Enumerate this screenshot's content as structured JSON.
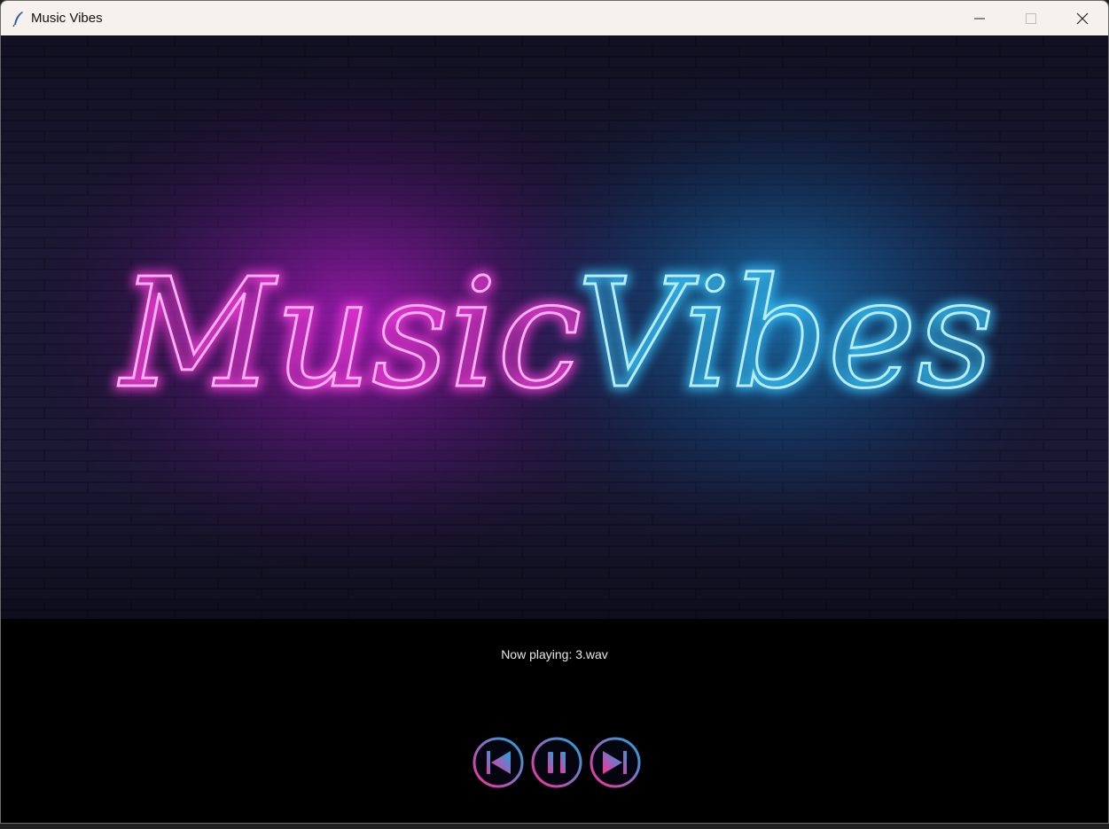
{
  "window": {
    "title": "Music Vibes",
    "app_icon": "feather-icon",
    "controls": [
      "minimize-icon",
      "maximize-icon",
      "close-icon"
    ]
  },
  "hero": {
    "sign_left": "Music",
    "sign_right": "Vibes",
    "left_color": "#ff3ee0",
    "right_color": "#35c8ff",
    "background": "brick-wall"
  },
  "status": {
    "now_playing": "Now playing: 3.wav"
  },
  "player_controls": [
    {
      "name": "previous",
      "icon": "skip-previous-icon"
    },
    {
      "name": "pause",
      "icon": "pause-icon"
    },
    {
      "name": "next",
      "icon": "skip-next-icon"
    }
  ],
  "colors": {
    "button_gradient_start": "#ff2d9c",
    "button_gradient_end": "#1aa9e0"
  }
}
